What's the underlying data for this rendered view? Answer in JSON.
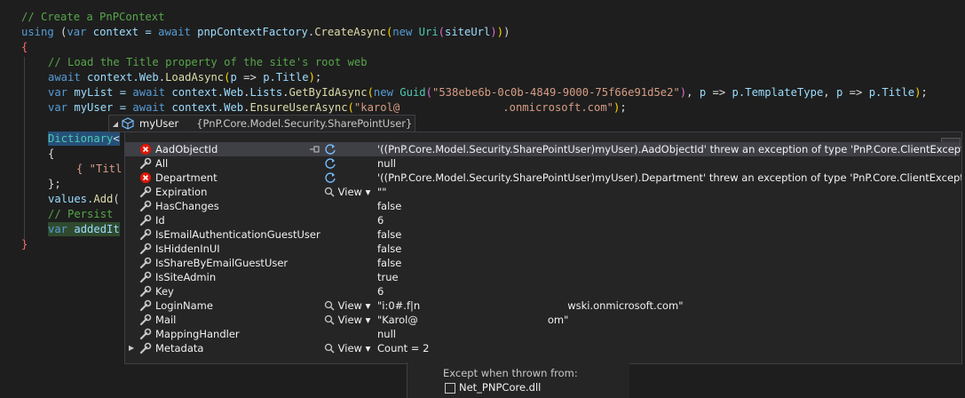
{
  "code": {
    "line1": "// Create a PnPContext",
    "line2": {
      "kw": "using",
      "rest": " (",
      "var": "var",
      "ctx": " context = ",
      "aw": "await",
      "factory": " pnpContextFactory.",
      "fn": "CreateAsync",
      "new": "new",
      "uri": "Uri",
      "arg": "siteUrl"
    },
    "line3": "{",
    "line4": "// Load the Title property of the site's root web",
    "line5": {
      "aw": "await",
      "obj": " context.",
      "web": "Web",
      "fn": "LoadAsync",
      "p1": "p",
      "arrow": " => ",
      "prop": "Title"
    },
    "line6": {
      "var": "var",
      "name": " myList = ",
      "aw": "await",
      "obj": " context.",
      "web": "Web",
      "lists": "Lists",
      "fn": "GetByIdAsync",
      "new": "new",
      "guid": "Guid",
      "str": "\"538ebe6b-0c0b-4849-9000-75f66e91d5e2\"",
      "p": "p",
      "arrow": " => ",
      "tt": "TemplateType",
      "title": "Title"
    },
    "line7": {
      "var": "var",
      "name": " myUser = ",
      "aw": "await",
      "obj": " context.",
      "web": "Web",
      "fn": "EnsureUserAsync",
      "str": "\"karol@",
      "str2": ".onmicrosoft.com\""
    },
    "line9": "Dictionary",
    "line10": "{",
    "line11": "{ \"Titl",
    "line12": "};",
    "line13": "values.Add(",
    "line14": "// Persist",
    "line15": "var addedIt",
    "line16": "}"
  },
  "datatip": {
    "header_name": "myUser",
    "header_type": "{PnP.Core.Model.Security.SharePointUser}",
    "rows": [
      {
        "name": "AadObjectId",
        "icon": "error-icon",
        "value": "'((PnP.Core.Model.Security.SharePointUser)myUser).AadObjectId' threw an exception of type 'PnP.Core.ClientException'",
        "refresh": true
      },
      {
        "name": "All",
        "icon": "wrench-icon",
        "value": "null",
        "refresh": true
      },
      {
        "name": "Department",
        "icon": "error-icon",
        "value": "'((PnP.Core.Model.Security.SharePointUser)myUser).Department' threw an exception of type 'PnP.Core.ClientException'",
        "refresh": true
      },
      {
        "name": "Expiration",
        "icon": "wrench-icon",
        "value": "\"\"",
        "view": "View"
      },
      {
        "name": "HasChanges",
        "icon": "wrench-icon",
        "value": "false"
      },
      {
        "name": "Id",
        "icon": "wrench-icon",
        "value": "6"
      },
      {
        "name": "IsEmailAuthenticationGuestUser",
        "icon": "wrench-icon",
        "value": "false"
      },
      {
        "name": "IsHiddenInUI",
        "icon": "wrench-icon",
        "value": "false"
      },
      {
        "name": "IsShareByEmailGuestUser",
        "icon": "wrench-icon",
        "value": "false"
      },
      {
        "name": "IsSiteAdmin",
        "icon": "wrench-icon",
        "value": "true"
      },
      {
        "name": "Key",
        "icon": "wrench-icon",
        "value": "6"
      },
      {
        "name": "LoginName",
        "icon": "wrench-icon",
        "value": "\"i:0#.f|n",
        "value2": "wski.onmicrosoft.com\"",
        "view": "View"
      },
      {
        "name": "Mail",
        "icon": "wrench-icon",
        "value": "\"Karol@",
        "value2": "om\"",
        "view": "View"
      },
      {
        "name": "MappingHandler",
        "icon": "wrench-icon",
        "value": "null"
      },
      {
        "name": "Metadata",
        "icon": "wrench-icon",
        "value": "Count = 2",
        "view": "View",
        "expandable": true
      }
    ]
  },
  "bottom_panel": {
    "line1": "Except when thrown from:",
    "checkbox_label": "Net_PNPCore.dll"
  },
  "colors": {
    "accent": "#007acc",
    "error": "#e51400",
    "bg": "#1e1e1e"
  }
}
